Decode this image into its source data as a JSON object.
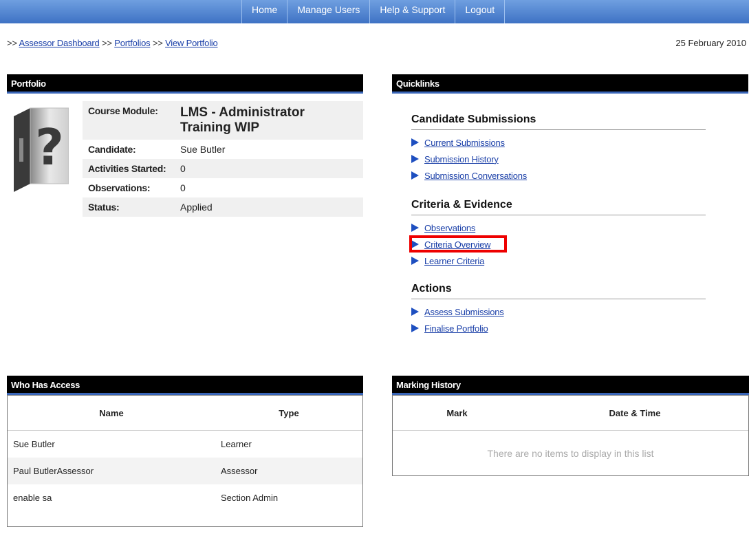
{
  "nav": {
    "items": [
      "Home",
      "Manage Users",
      "Help & Support",
      "Logout"
    ]
  },
  "breadcrumb": {
    "prefix": ">>",
    "items": [
      "Assessor Dashboard",
      "Portfolios",
      "View Portfolio"
    ],
    "separator": ">>"
  },
  "date": "25 February 2010",
  "portfolio": {
    "title": "Portfolio",
    "rows": [
      {
        "label": "Course Module:",
        "value": "LMS - Administrator Training WIP"
      },
      {
        "label": "Candidate:",
        "value": "Sue Butler"
      },
      {
        "label": "Activities Started:",
        "value": "0"
      },
      {
        "label": "Observations:",
        "value": "0"
      },
      {
        "label": "Status:",
        "value": "Applied"
      }
    ]
  },
  "quicklinks": {
    "title": "Quicklinks",
    "sections": [
      {
        "title": "Candidate Submissions",
        "links": [
          "Current Submissions",
          "Submission History",
          "Submission Conversations"
        ]
      },
      {
        "title": "Criteria & Evidence",
        "links": [
          "Observations",
          "Criteria Overview",
          "Learner Criteria"
        ]
      },
      {
        "title": "Actions",
        "links": [
          "Assess Submissions",
          "Finalise Portfolio"
        ]
      }
    ]
  },
  "access": {
    "title": "Who Has Access",
    "columns": [
      "Name",
      "Type"
    ],
    "rows": [
      [
        "Sue Butler",
        "Learner"
      ],
      [
        "Paul ButlerAssessor",
        "Assessor"
      ],
      [
        "enable sa",
        "Section Admin"
      ]
    ]
  },
  "marking": {
    "title": "Marking History",
    "columns": [
      "Mark",
      "Date & Time"
    ],
    "empty_text": "There are no items to display in this list"
  },
  "colors": {
    "nav_top": "#6f9fe0",
    "nav_bottom": "#3e72c4",
    "link": "#1a3fa8",
    "highlight": "#ee0000",
    "header_bg": "#000000"
  }
}
